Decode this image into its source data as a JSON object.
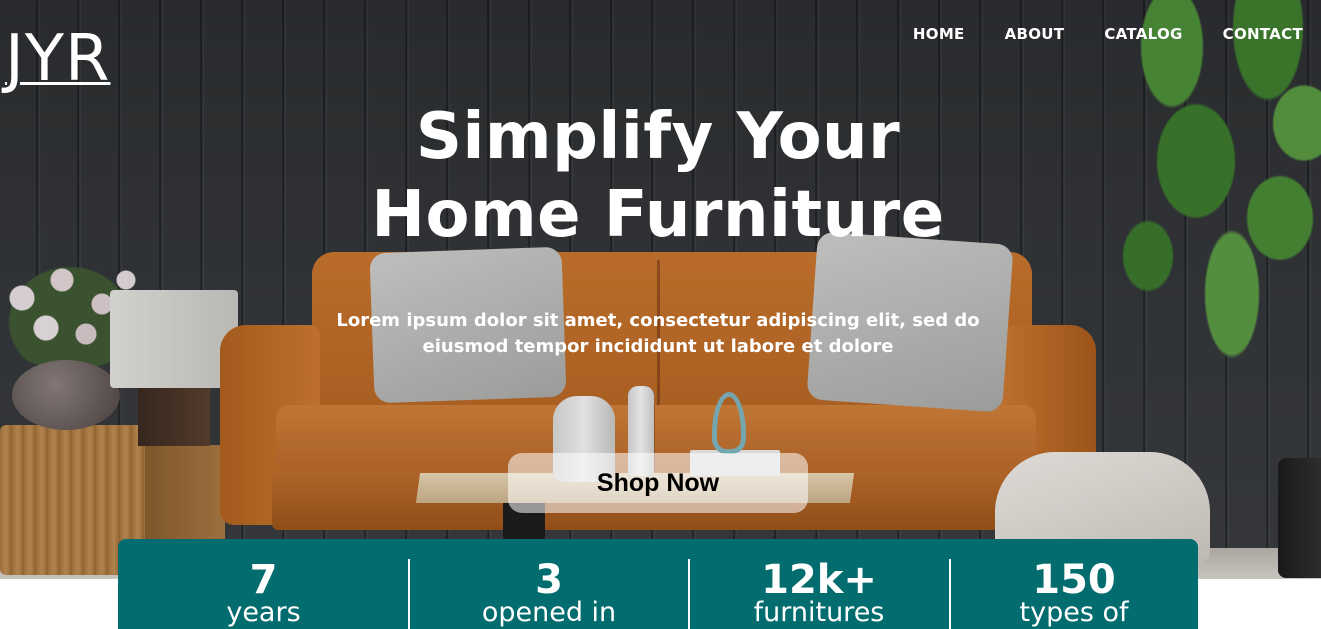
{
  "brand": {
    "logo_text": "JYR"
  },
  "nav": {
    "items": [
      {
        "label": "HOME"
      },
      {
        "label": "ABOUT"
      },
      {
        "label": "CATALOG"
      },
      {
        "label": "CONTACT"
      }
    ]
  },
  "hero": {
    "headline_line1": "Simplify Your",
    "headline_line2": "Home Furniture",
    "subtext": "Lorem ipsum dolor sit amet, consectetur adipiscing elit, sed do eiusmod tempor incididunt ut labore et dolore",
    "cta_label": "Shop Now"
  },
  "stats": [
    {
      "value": "7",
      "label": "years"
    },
    {
      "value": "3",
      "label": "opened in"
    },
    {
      "value": "12k+",
      "label": "furnitures"
    },
    {
      "value": "150",
      "label": "types of"
    }
  ],
  "colors": {
    "stats_background": "#036c6e",
    "text_primary": "#ffffff",
    "button_text": "#000000"
  }
}
